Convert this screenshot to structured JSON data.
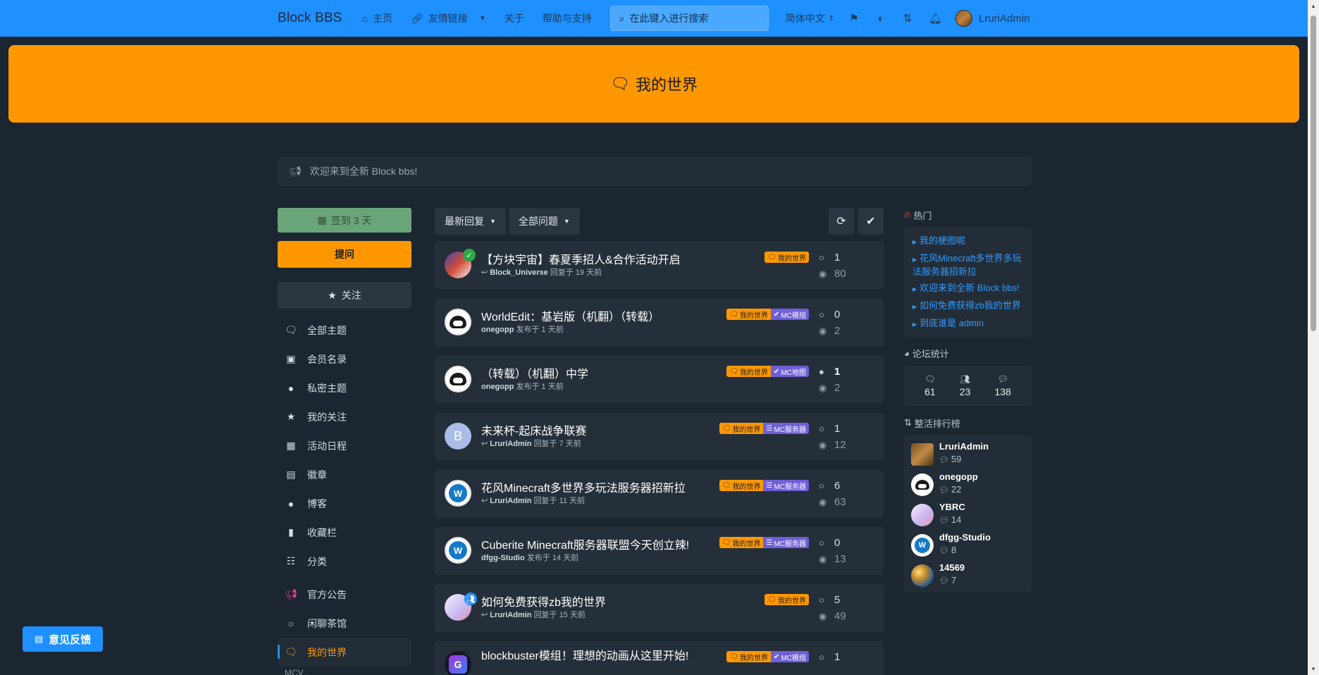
{
  "header": {
    "brand": "Block BBS",
    "nav": [
      {
        "label": "主页",
        "icon": "home-icon"
      },
      {
        "label": "友情链接",
        "icon": "link-icon",
        "dropdown": true
      },
      {
        "label": "关于"
      },
      {
        "label": "帮助与支持"
      }
    ],
    "search_placeholder": "在此键入进行搜索",
    "language": "简体中文",
    "username": "LruriAdmin",
    "icons": [
      "flag-icon",
      "contrast-icon",
      "sort-icon",
      "bell-icon"
    ]
  },
  "hero": {
    "title": "我的世界",
    "icon": "comments-icon",
    "color": "#ff9800"
  },
  "announcement": {
    "text": "欢迎来到全新 Block bbs!",
    "icon": "megaphone-icon"
  },
  "left_sidebar": {
    "sign_in": "签到 3 天",
    "ask": "提问",
    "follow": "关注",
    "items": [
      {
        "label": "全部主题",
        "icon": "comments-icon"
      },
      {
        "label": "会员名录",
        "icon": "address-book-icon"
      },
      {
        "label": "私密主题",
        "icon": "comment-icon"
      },
      {
        "label": "我的关注",
        "icon": "star-icon"
      },
      {
        "label": "活动日程",
        "icon": "calendar-icon"
      },
      {
        "label": "徽章",
        "icon": "id-badge-icon"
      },
      {
        "label": "博客",
        "icon": "comment-icon"
      },
      {
        "label": "收藏栏",
        "icon": "bookmark-icon"
      },
      {
        "label": "分类",
        "icon": "list-icon"
      },
      {
        "label": "官方公告",
        "icon": "megaphone-icon"
      },
      {
        "label": "闲聊茶馆",
        "icon": "comment-icon"
      },
      {
        "label": "我的世界",
        "icon": "comments-icon",
        "active": true
      }
    ],
    "peek": "MCV..."
  },
  "toolbar": {
    "sort": "最新回复",
    "filter": "全部问题"
  },
  "topics": [
    {
      "title": "【方块宇宙】春夏季招人&合作活动开启",
      "author": "Block_Universe",
      "action": "回复于 19 天前",
      "reply_icon": true,
      "tags": [
        "我的世界"
      ],
      "replies": "1",
      "views": "80"
    },
    {
      "title": "WorldEdit：基岩版（机翻）（转载）",
      "author": "onegopp",
      "action": "发布于 1 天前",
      "reply_icon": false,
      "tags": [
        "我的世界",
        "MC模组"
      ],
      "replies": "0",
      "views": "2"
    },
    {
      "title": "（转载）（机翻）中学",
      "author": "onegopp",
      "action": "发布于 1 天前",
      "reply_icon": false,
      "tags": [
        "我的世界",
        "MC地图"
      ],
      "replies": "1",
      "views": "2"
    },
    {
      "title": "未来杯-起床战争联赛",
      "author": "LruriAdmin",
      "action": "回复于 7 天前",
      "reply_icon": true,
      "tags": [
        "我的世界",
        "MC服务器"
      ],
      "replies": "1",
      "views": "12",
      "avatar_letter": "B"
    },
    {
      "title": "花风Minecraft多世界多玩法服务器招新拉",
      "author": "LruriAdmin",
      "action": "回复于 11 天前",
      "reply_icon": true,
      "tags": [
        "我的世界",
        "MC服务器"
      ],
      "replies": "6",
      "views": "63"
    },
    {
      "title": "Cuberite Minecraft服务器联盟今天创立辣!",
      "author": "dfgg-Studio",
      "action": "发布于 14 天前",
      "reply_icon": false,
      "tags": [
        "我的世界",
        "MC服务器"
      ],
      "replies": "0",
      "views": "13"
    },
    {
      "title": "如何免费获得zb我的世界",
      "author": "LruriAdmin",
      "action": "回复于 15 天前",
      "reply_icon": true,
      "tags": [
        "我的世界"
      ],
      "replies": "5",
      "views": "49"
    },
    {
      "title": "blockbuster模组！理想的动画从这里开始!",
      "tags": [
        "我的世界",
        "MC模组"
      ],
      "replies": "1"
    }
  ],
  "right_sidebar": {
    "hot_title": "热门",
    "hot_items": [
      "我的梗图呢",
      "花风Minecraft多世界多玩法服务器招新拉",
      "欢迎来到全新 Block bbs!",
      "如何免费获得zb我的世界",
      "到底谁是 admin"
    ],
    "stats_title": "论坛统计",
    "stats": [
      "61",
      "23",
      "138"
    ],
    "rank_title": "整活排行榜",
    "ranking": [
      {
        "name": "LruriAdmin",
        "count": "59"
      },
      {
        "name": "onegopp",
        "count": "22"
      },
      {
        "name": "YBRC",
        "count": "14"
      },
      {
        "name": "dfgg-Studio",
        "count": "8"
      },
      {
        "name": "14569",
        "count": "7"
      }
    ]
  },
  "feedback": {
    "label": "意见反馈"
  }
}
